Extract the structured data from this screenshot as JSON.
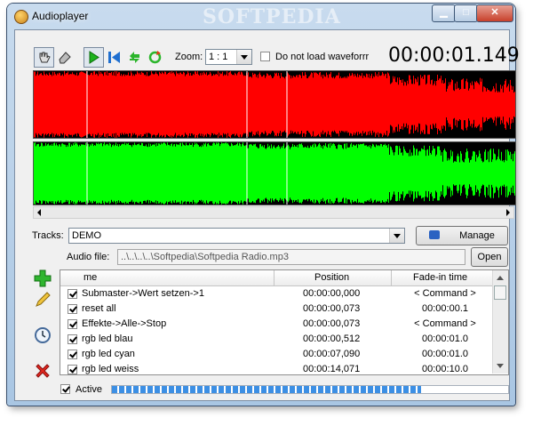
{
  "window": {
    "title": "Audioplayer",
    "watermark": "SOFTPEDIA"
  },
  "toolbar": {
    "zoom_label": "Zoom:",
    "zoom_value": "1 : 1",
    "no_waveform_label": "Do not load waveforrr",
    "no_waveform_checked": false,
    "time": "00:00:01.149",
    "icons": [
      "hand-icon",
      "eraser-icon",
      "play-icon",
      "skip-back-icon",
      "arrows-icon",
      "loop-icon"
    ]
  },
  "waveform": {
    "top_color": "#ff0000",
    "bottom_color": "#00ff00"
  },
  "tracks": {
    "label": "Tracks:",
    "value": "DEMO",
    "manage_label": "Manage"
  },
  "audio_file": {
    "label": "Audio file:",
    "value": "..\\..\\..\\..\\Softpedia\\Softpedia Radio.mp3",
    "open_label": "Open"
  },
  "table": {
    "columns": [
      "me",
      "Position",
      "Fade-in time"
    ],
    "rows": [
      {
        "name": "Submaster->Wert setzen->1",
        "position": "00:00:00,000",
        "fade": "< Command >",
        "checked": true
      },
      {
        "name": "reset all",
        "position": "00:00:00,073",
        "fade": "00:00:00.1",
        "checked": true
      },
      {
        "name": "Effekte->Alle->Stop",
        "position": "00:00:00,073",
        "fade": "< Command >",
        "checked": true
      },
      {
        "name": "rgb led blau",
        "position": "00:00:00,512",
        "fade": "00:00:01.0",
        "checked": true
      },
      {
        "name": "rgb led cyan",
        "position": "00:00:07,090",
        "fade": "00:00:01.0",
        "checked": true
      },
      {
        "name": "rgb led weiss",
        "position": "00:00:14,071",
        "fade": "00:00:10.0",
        "checked": true
      }
    ]
  },
  "footer": {
    "active_label": "Active",
    "active_checked": true,
    "progress": 0.78
  }
}
